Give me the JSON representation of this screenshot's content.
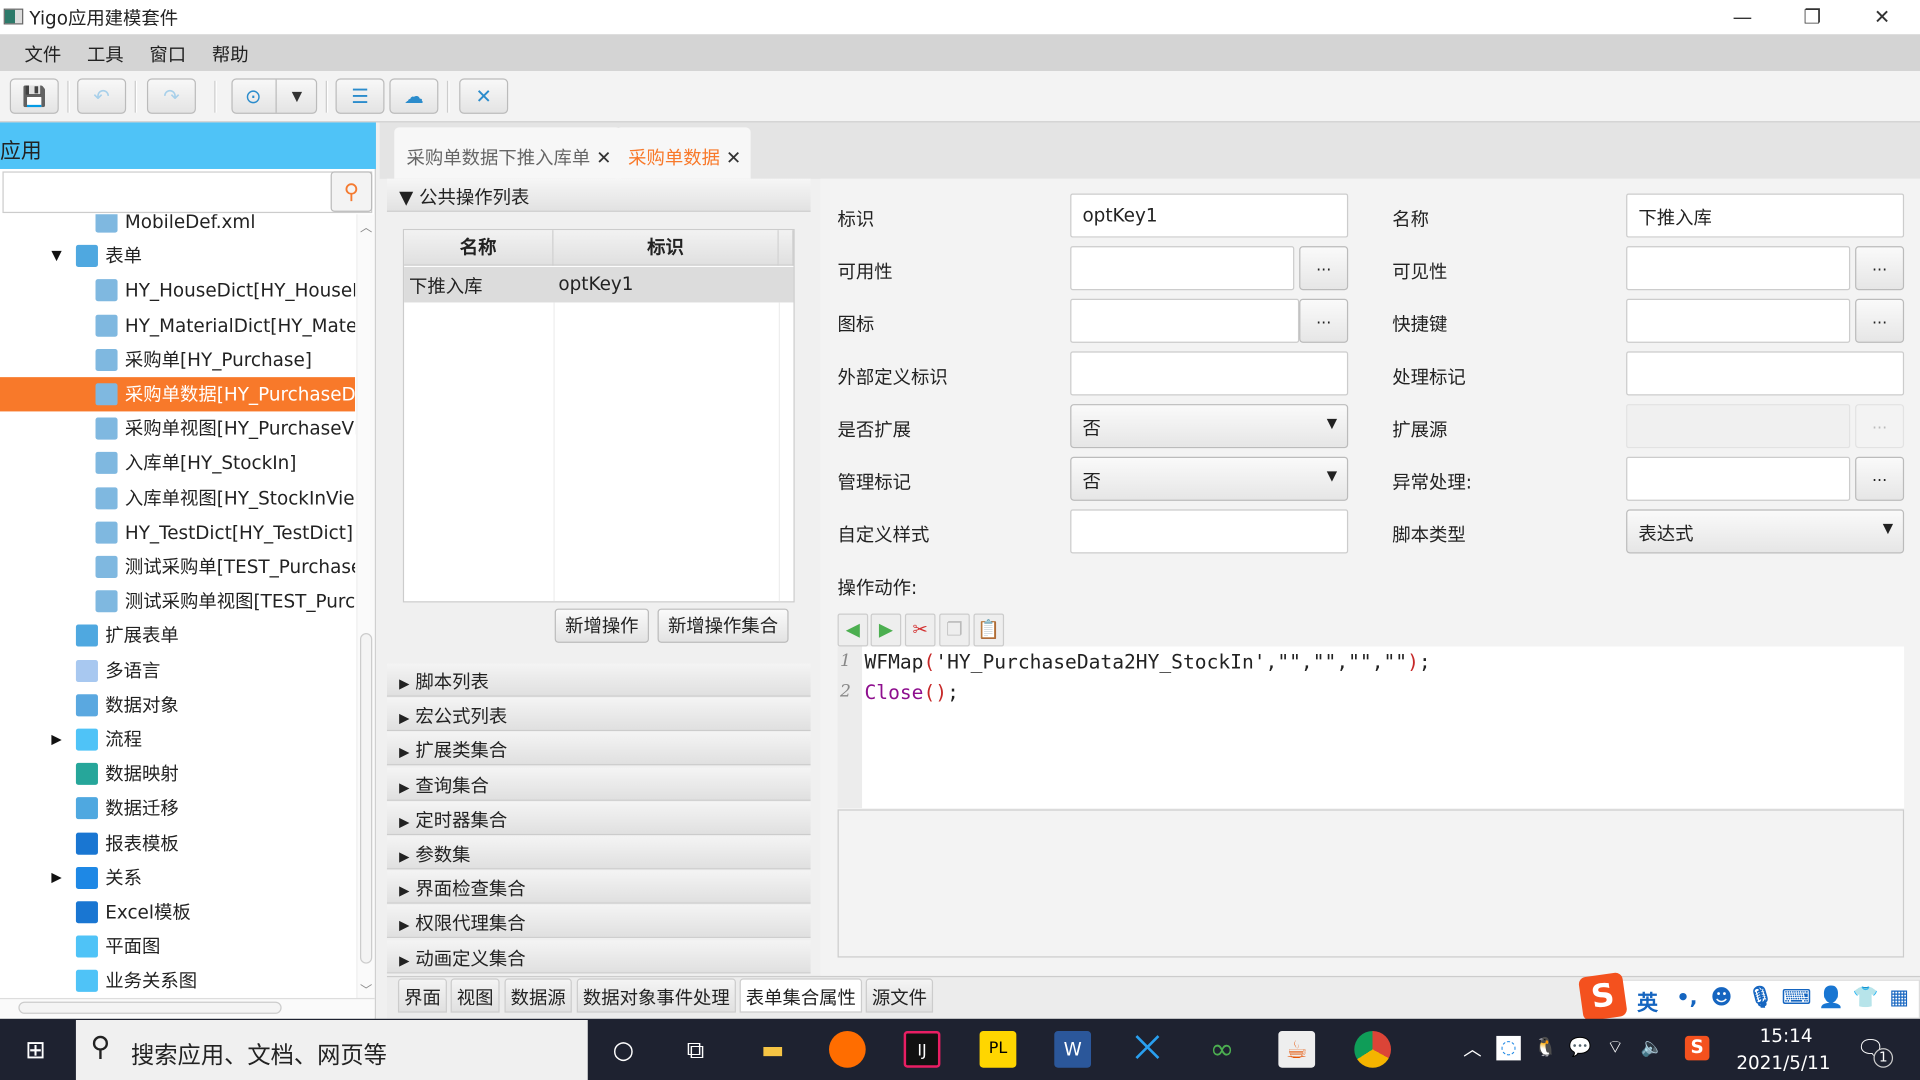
{
  "window": {
    "title": "Yigo应用建模套件",
    "minimize": "—",
    "restore": "❐",
    "close": "✕"
  },
  "menu": [
    "文件",
    "工具",
    "窗口",
    "帮助"
  ],
  "toolbar": {
    "icons": [
      "save-icon",
      "undo-icon",
      "redo-icon",
      "comment-icon",
      "dropdown-icon",
      "database-icon",
      "upload-icon",
      "tools-icon"
    ]
  },
  "left": {
    "header": "应用",
    "search_placeholder": "",
    "tree": [
      {
        "label": "MobileDef.xml",
        "indent": 2,
        "icon": "form"
      },
      {
        "label": "表单",
        "indent": 1,
        "icon": "folder",
        "arrow": "▼"
      },
      {
        "label": "HY_HouseDict[HY_HouseDict]",
        "indent": 2,
        "icon": "form"
      },
      {
        "label": "HY_MaterialDict[HY_MaterialDict]",
        "indent": 2,
        "icon": "form"
      },
      {
        "label": "采购单[HY_Purchase]",
        "indent": 2,
        "icon": "form"
      },
      {
        "label": "采购单数据[HY_PurchaseData]",
        "indent": 2,
        "icon": "form",
        "selected": true
      },
      {
        "label": "采购单视图[HY_PurchaseView]",
        "indent": 2,
        "icon": "form"
      },
      {
        "label": "入库单[HY_StockIn]",
        "indent": 2,
        "icon": "form"
      },
      {
        "label": "入库单视图[HY_StockInView]",
        "indent": 2,
        "icon": "form"
      },
      {
        "label": "HY_TestDict[HY_TestDict]",
        "indent": 2,
        "icon": "form"
      },
      {
        "label": "测试采购单[TEST_Purchase]",
        "indent": 2,
        "icon": "form"
      },
      {
        "label": "测试采购单视图[TEST_PurchaseView]",
        "indent": 2,
        "icon": "form"
      },
      {
        "label": "扩展表单",
        "indent": 1,
        "icon": "folder"
      },
      {
        "label": "多语言",
        "indent": 1,
        "icon": "i18n"
      },
      {
        "label": "数据对象",
        "indent": 1,
        "icon": "dataobj"
      },
      {
        "label": "流程",
        "indent": 1,
        "icon": "flow",
        "arrow": "▶"
      },
      {
        "label": "数据映射",
        "indent": 1,
        "icon": "db"
      },
      {
        "label": "数据迁移",
        "indent": 1,
        "icon": "migrate"
      },
      {
        "label": "报表模板",
        "indent": 1,
        "icon": "chart"
      },
      {
        "label": "关系",
        "indent": 1,
        "icon": "relation",
        "arrow": "▶"
      },
      {
        "label": "Excel模板",
        "indent": 1,
        "icon": "chart"
      },
      {
        "label": "平面图",
        "indent": 1,
        "icon": "flow"
      },
      {
        "label": "业务关系图",
        "indent": 1,
        "icon": "flow"
      }
    ]
  },
  "tabs": [
    {
      "label": "采购单数据下推入库单",
      "active": false
    },
    {
      "label": "采购单数据",
      "active": true
    }
  ],
  "center": {
    "section": "公共操作列表",
    "columns": [
      "名称",
      "标识"
    ],
    "rows": [
      [
        "下推入库",
        "optKey1"
      ]
    ],
    "add_op": "新增操作",
    "add_op_set": "新增操作集合",
    "collapsed": [
      "脚本列表",
      "宏公式列表",
      "扩展类集合",
      "查询集合",
      "定时器集合",
      "参数集",
      "界面检查集合",
      "权限代理集合",
      "动画定义集合"
    ]
  },
  "form": {
    "key_label": "标识",
    "key": "optKey1",
    "name_label": "名称",
    "name": "下推入库",
    "enable_label": "可用性",
    "visible_label": "可见性",
    "icon_label": "图标",
    "shortcut_label": "快捷键",
    "refkey_label": "外部定义标识",
    "handle_label": "处理标记",
    "expand_label": "是否扩展",
    "expand": "否",
    "expsrc_label": "扩展源",
    "manage_label": "管理标记",
    "manage": "否",
    "exception_label": "异常处理:",
    "style_label": "自定义样式",
    "script_type_label": "脚本类型",
    "script_type": "表达式",
    "dots": "...",
    "action_label": "操作动作:",
    "code_lines": [
      {
        "n": "1",
        "parts": [
          {
            "t": "WFMap",
            "c": "#222"
          },
          {
            "t": "(",
            "c": "#c62828"
          },
          {
            "t": "'HY_PurchaseData2HY_StockIn',\"\",\"\",\"\",\"\"",
            "c": "#222"
          },
          {
            "t": ")",
            "c": "#c62828"
          },
          {
            "t": ";",
            "c": "#222"
          }
        ]
      },
      {
        "n": "2",
        "parts": [
          {
            "t": "Close",
            "c": "#8e0e8e"
          },
          {
            "t": "()",
            "c": "#c62828"
          },
          {
            "t": ";",
            "c": "#222"
          }
        ]
      }
    ]
  },
  "bottom_tabs": [
    {
      "label": "界面"
    },
    {
      "label": "视图"
    },
    {
      "label": "数据源"
    },
    {
      "label": "数据对象事件处理"
    },
    {
      "label": "表单集合属性",
      "active": true
    },
    {
      "label": "源文件"
    }
  ],
  "ime": {
    "mode": "英",
    "punct": "•,"
  },
  "taskbar": {
    "search": "搜索应用、文档、网页等",
    "time": "15:14",
    "date": "2021/5/11",
    "notifications": "1"
  },
  "colors": {
    "accent": "#f8792a",
    "header": "#4fc3f7",
    "taskbar": "#1e2230"
  }
}
